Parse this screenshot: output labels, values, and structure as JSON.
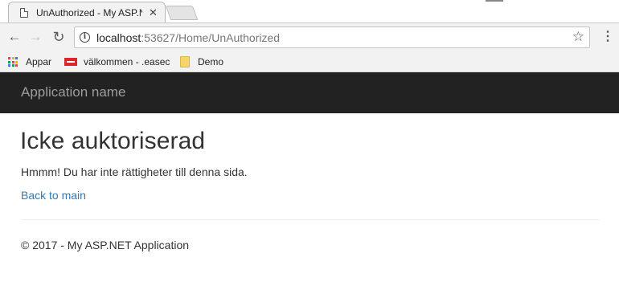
{
  "browser": {
    "tab": {
      "title": "UnAuthorized - My ASP.N",
      "close_glyph": "✕"
    },
    "toolbar": {
      "back_glyph": "←",
      "forward_glyph": "→",
      "reload_glyph": "↻",
      "url_host": "localhost",
      "url_path": ":53627/Home/UnAuthorized",
      "star_glyph": "☆",
      "menu_glyph": "⋮"
    },
    "bookmarks": [
      {
        "label": "Appar",
        "icon": "apps-grid-icon"
      },
      {
        "label": "välkommen - .easec",
        "icon": "flag-icon"
      },
      {
        "label": "Demo",
        "icon": "folder-icon"
      }
    ]
  },
  "page": {
    "navbar": {
      "brand": "Application name"
    },
    "title": "Icke auktoriserad",
    "message": "Hmmm! Du har inte rättigheter till denna sida.",
    "back_link": "Back to main",
    "footer": "© 2017 - My ASP.NET Application"
  },
  "colors": {
    "navbar_bg": "#222222",
    "brand_text": "#9d9d9d",
    "link": "#337ab7",
    "text": "#333333",
    "apps_grid": [
      "#e8453c",
      "#f4b400",
      "#3b78e7",
      "#0f9d58",
      "#e8453c",
      "#f4b400",
      "#3b78e7",
      "#0f9d58",
      "#e8453c"
    ]
  }
}
